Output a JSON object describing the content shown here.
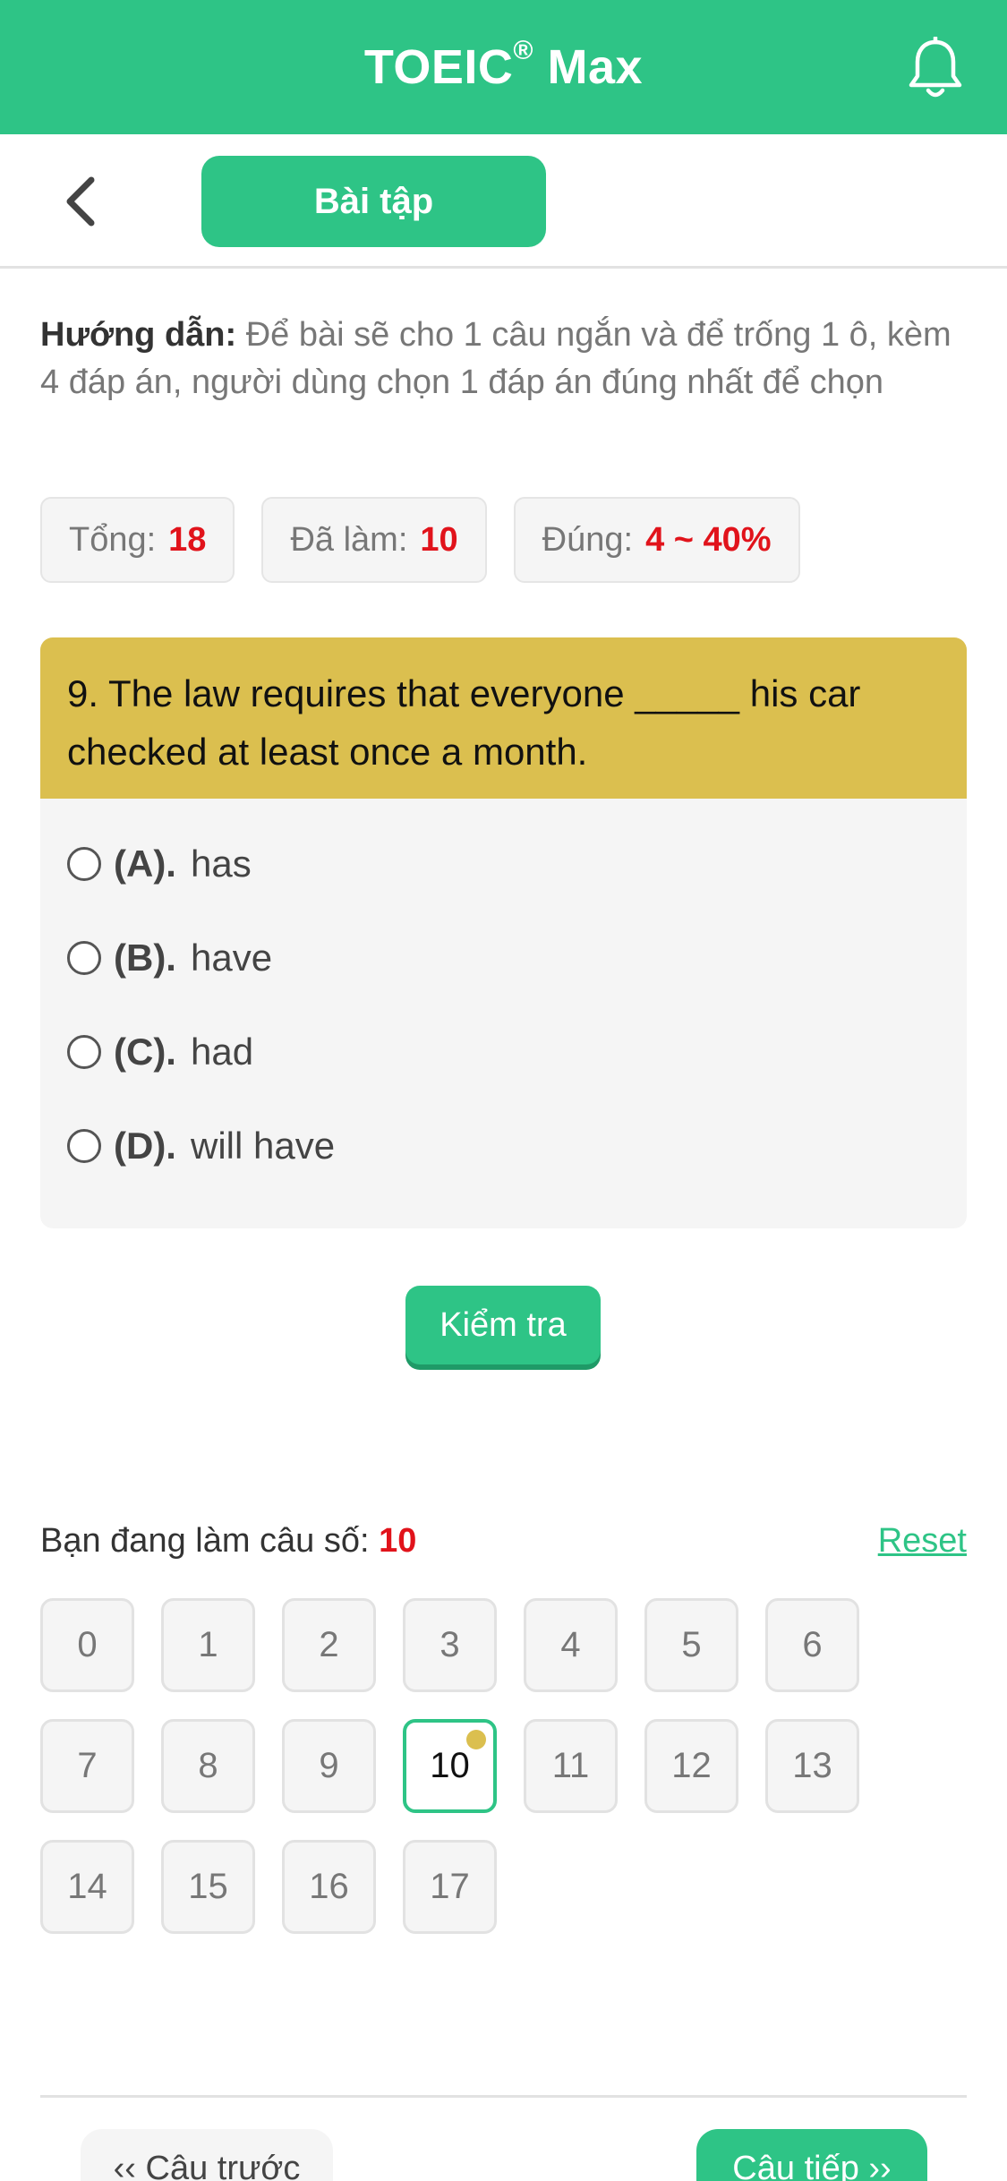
{
  "header": {
    "title": "TOEIC",
    "title_sup": "®",
    "title_suffix": " Max",
    "bell_icon": "bell-icon"
  },
  "subheader": {
    "back_icon": "chevron-left-icon",
    "section_label": "Bài tập"
  },
  "instructions": {
    "lead": "Hướng dẫn:",
    "text": " Để bài sẽ cho 1 câu ngắn và để trống 1 ô, kèm 4 đáp án, người dùng chọn 1 đáp án đúng nhất để chọn"
  },
  "stats": [
    {
      "label": "Tổng:",
      "value": "18"
    },
    {
      "label": "Đã làm:",
      "value": "10"
    },
    {
      "label": "Đúng:",
      "value": "4 ~ 40%"
    }
  ],
  "question": {
    "text": "9. The law requires that everyone _____ his car checked at least once a month.",
    "options": [
      {
        "key": "(A).",
        "text": "has"
      },
      {
        "key": "(B).",
        "text": "have"
      },
      {
        "key": "(C).",
        "text": "had"
      },
      {
        "key": "(D).",
        "text": "will have"
      }
    ]
  },
  "check_label": "Kiểm tra",
  "progress": {
    "label": "Bạn đang làm câu số:",
    "current": "10",
    "reset_label": "Reset",
    "cells": [
      "0",
      "1",
      "2",
      "3",
      "4",
      "5",
      "6",
      "7",
      "8",
      "9",
      "10",
      "11",
      "12",
      "13",
      "14",
      "15",
      "16",
      "17"
    ],
    "active_index": 10
  },
  "nav": {
    "prev_label": "‹‹ Câu trước",
    "next_label": "Câu tiếp ››"
  },
  "colors": {
    "brand": "#2ec486",
    "question_bg": "#dbbf4f",
    "accent_red": "#e1131b"
  }
}
